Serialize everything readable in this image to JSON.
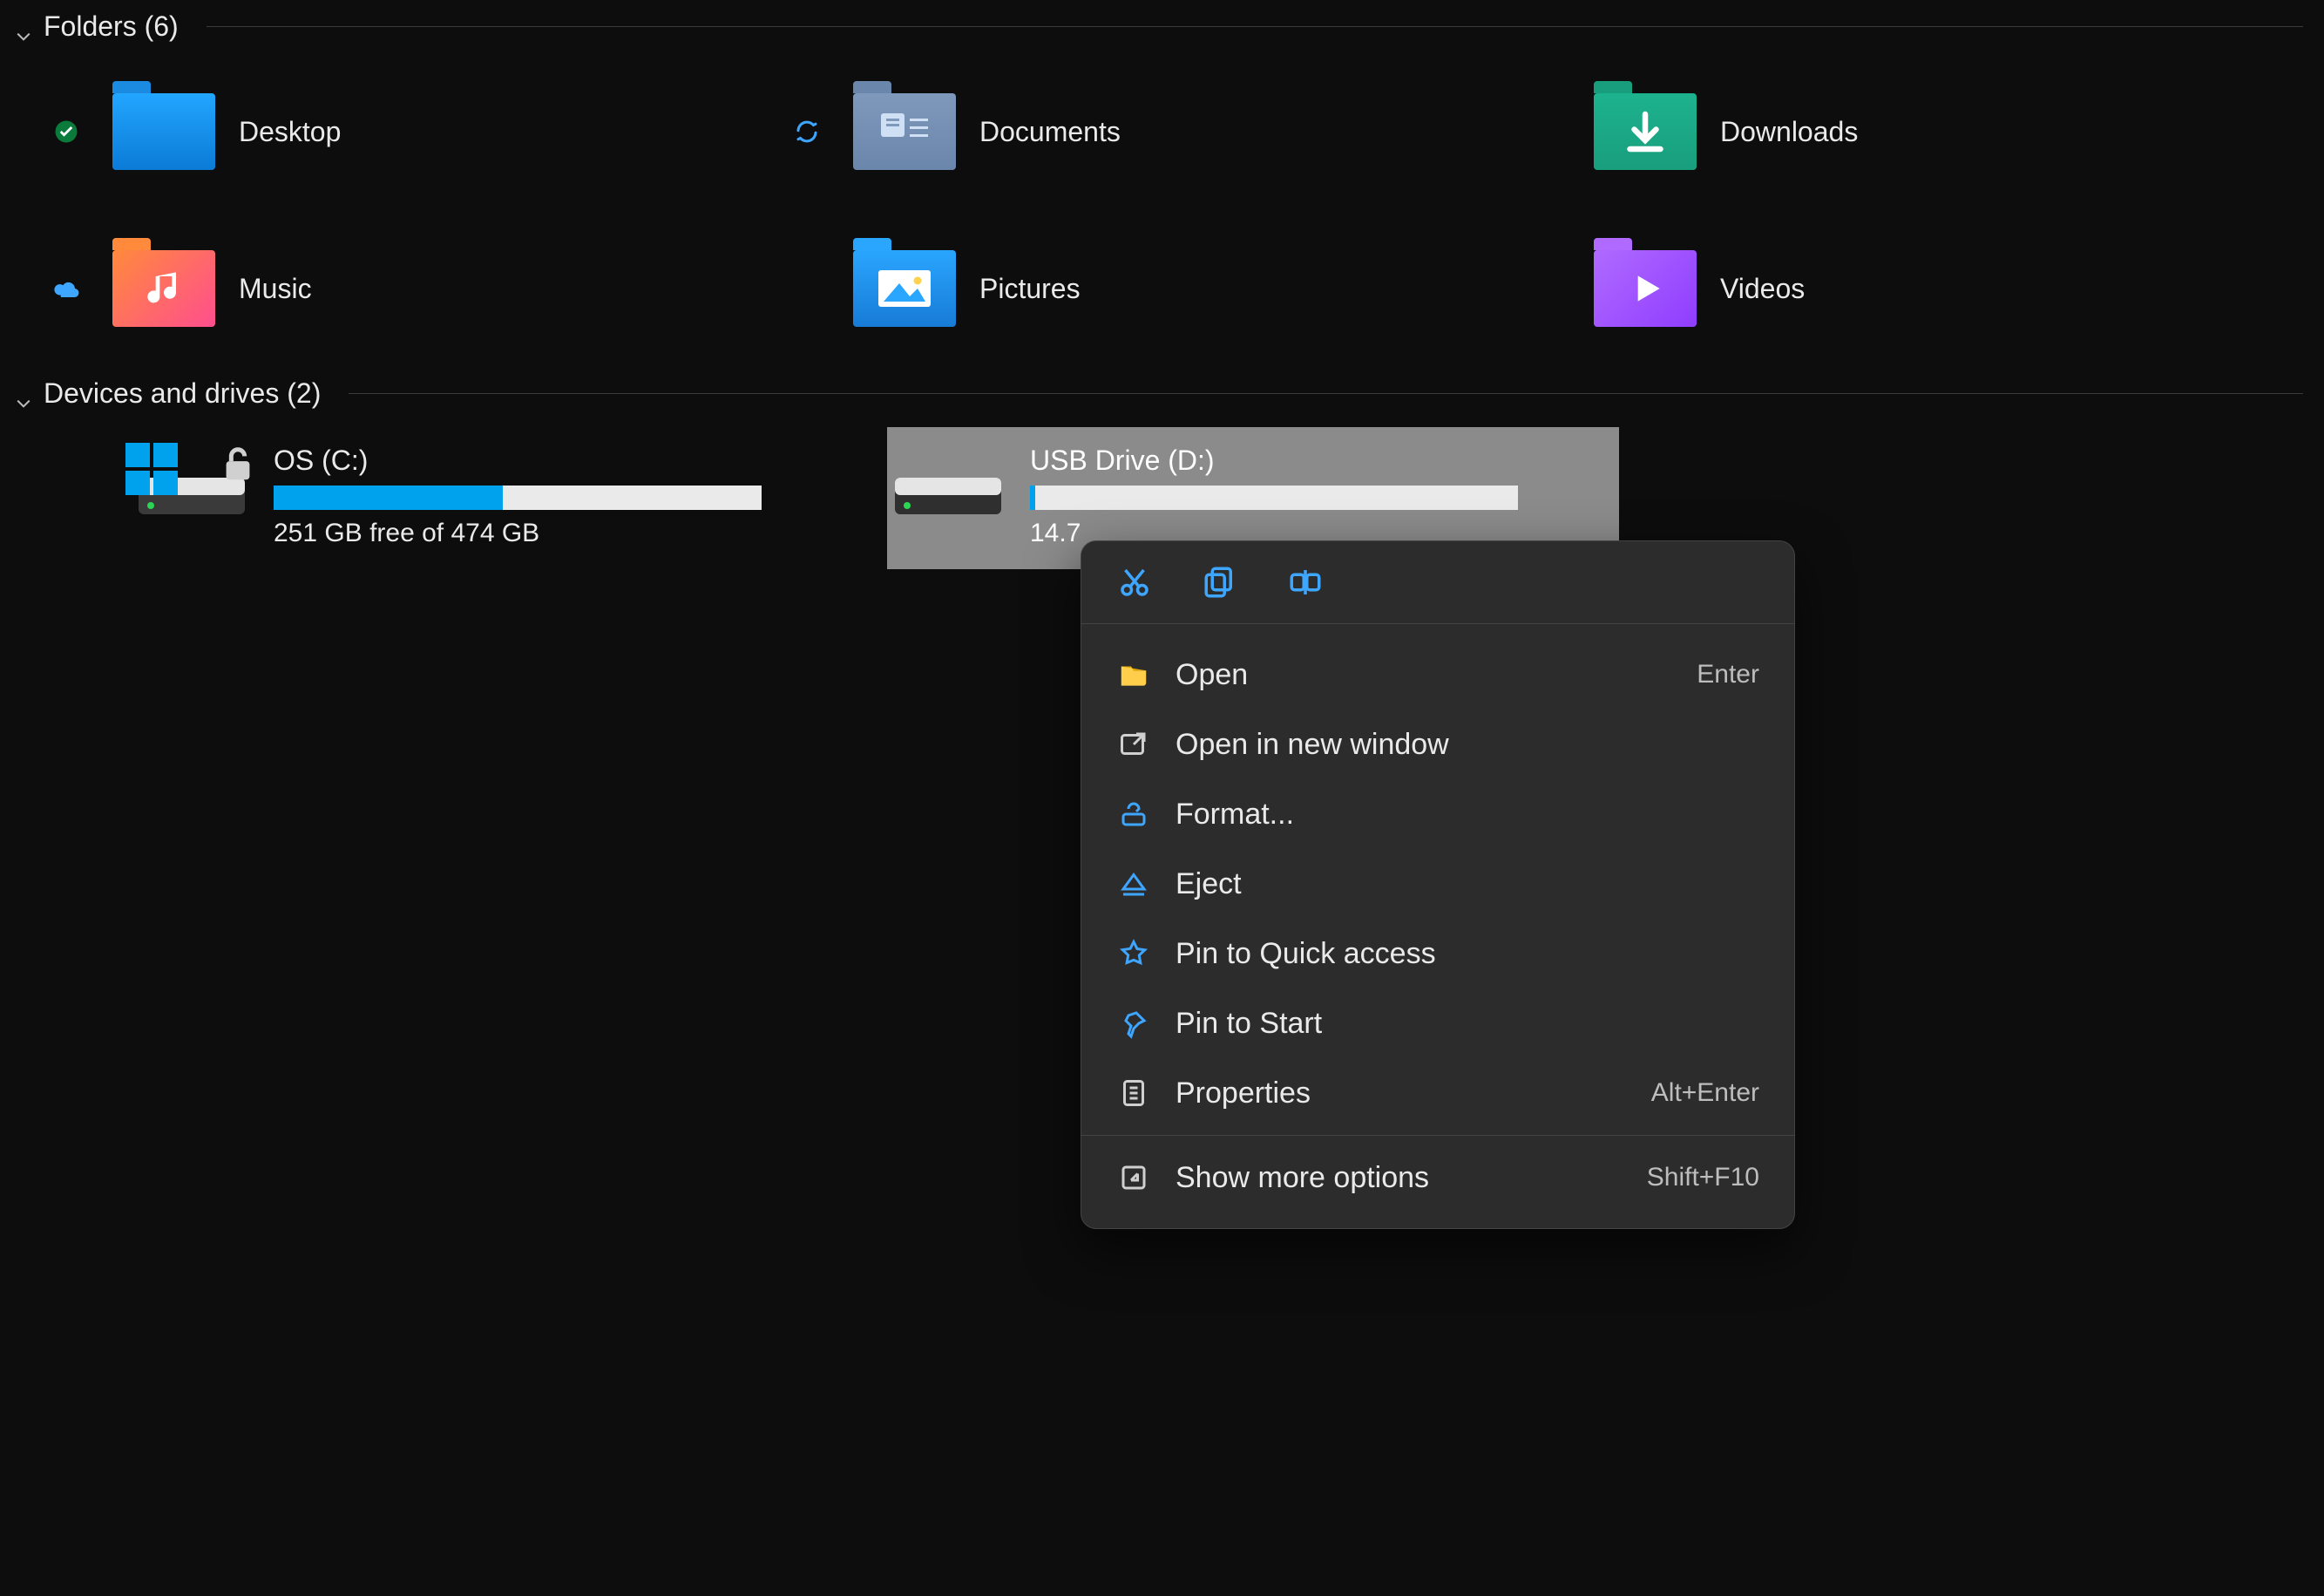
{
  "sections": {
    "folders": {
      "title": "Folders (6)"
    },
    "drives": {
      "title": "Devices and drives (2)"
    }
  },
  "folders": [
    {
      "label": "Desktop",
      "status": "synced"
    },
    {
      "label": "Documents",
      "status": "sync"
    },
    {
      "label": "Downloads",
      "status": null
    },
    {
      "label": "Music",
      "status": "cloud"
    },
    {
      "label": "Pictures",
      "status": null
    },
    {
      "label": "Videos",
      "status": null
    }
  ],
  "drives": [
    {
      "name": "OS (C:)",
      "free_text": "251 GB free of 474 GB",
      "used_pct": 47,
      "selected": false,
      "badge_windows": true,
      "badge_lock": true
    },
    {
      "name": "USB Drive (D:)",
      "free_text": "14.7",
      "used_pct": 1,
      "selected": true,
      "badge_windows": false,
      "badge_lock": false
    }
  ],
  "context_menu": {
    "toolbar": [
      {
        "name": "cut-icon"
      },
      {
        "name": "copy-icon"
      },
      {
        "name": "rename-icon"
      }
    ],
    "items": [
      {
        "icon": "open",
        "label": "Open",
        "shortcut": "Enter"
      },
      {
        "icon": "new-window",
        "label": "Open in new window",
        "shortcut": ""
      },
      {
        "icon": "format",
        "label": "Format...",
        "shortcut": ""
      },
      {
        "icon": "eject",
        "label": "Eject",
        "shortcut": ""
      },
      {
        "icon": "pin-quick",
        "label": "Pin to Quick access",
        "shortcut": ""
      },
      {
        "icon": "pin-start",
        "label": "Pin to Start",
        "shortcut": ""
      },
      {
        "icon": "properties",
        "label": "Properties",
        "shortcut": "Alt+Enter"
      }
    ],
    "more": {
      "icon": "show-more",
      "label": "Show more options",
      "shortcut": "Shift+F10"
    }
  }
}
